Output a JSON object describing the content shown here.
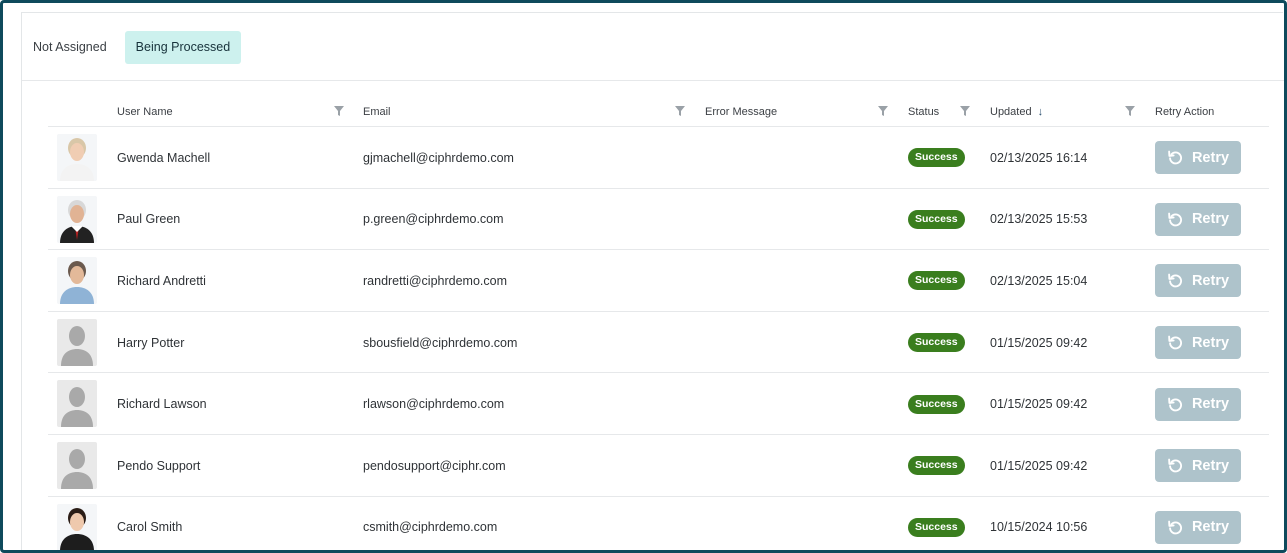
{
  "tabs": [
    {
      "label": "Not Assigned",
      "active": false
    },
    {
      "label": "Being Processed",
      "active": true
    }
  ],
  "columns": {
    "user_name": "User Name",
    "email": "Email",
    "error_message": "Error Message",
    "status": "Status",
    "updated": "Updated",
    "retry_action": "Retry Action"
  },
  "colors": {
    "accent_tab": "#cdf1ee",
    "success_badge": "#3a7e1e",
    "retry_button": "#aec3cb",
    "border": "#0e4a5c"
  },
  "rows": [
    {
      "name": "Gwenda Machell",
      "email": "gjmachell@ciphrdemo.com",
      "error": "",
      "status": "Success",
      "updated": "02/13/2025 16:14",
      "retry": "Retry",
      "avatar": "photo-woman-white"
    },
    {
      "name": "Paul Green",
      "email": "p.green@ciphrdemo.com",
      "error": "",
      "status": "Success",
      "updated": "02/13/2025 15:53",
      "retry": "Retry",
      "avatar": "photo-man-suit"
    },
    {
      "name": "Richard Andretti",
      "email": "randretti@ciphrdemo.com",
      "error": "",
      "status": "Success",
      "updated": "02/13/2025 15:04",
      "retry": "Retry",
      "avatar": "photo-man-blue"
    },
    {
      "name": "Harry Potter",
      "email": "sbousfield@ciphrdemo.com",
      "error": "",
      "status": "Success",
      "updated": "01/15/2025 09:42",
      "retry": "Retry",
      "avatar": "placeholder"
    },
    {
      "name": "Richard Lawson",
      "email": "rlawson@ciphrdemo.com",
      "error": "",
      "status": "Success",
      "updated": "01/15/2025 09:42",
      "retry": "Retry",
      "avatar": "placeholder"
    },
    {
      "name": "Pendo Support",
      "email": "pendosupport@ciphr.com",
      "error": "",
      "status": "Success",
      "updated": "01/15/2025 09:42",
      "retry": "Retry",
      "avatar": "placeholder"
    },
    {
      "name": "Carol Smith",
      "email": "csmith@ciphrdemo.com",
      "error": "",
      "status": "Success",
      "updated": "10/15/2024 10:56",
      "retry": "Retry",
      "avatar": "photo-woman-dark"
    }
  ]
}
